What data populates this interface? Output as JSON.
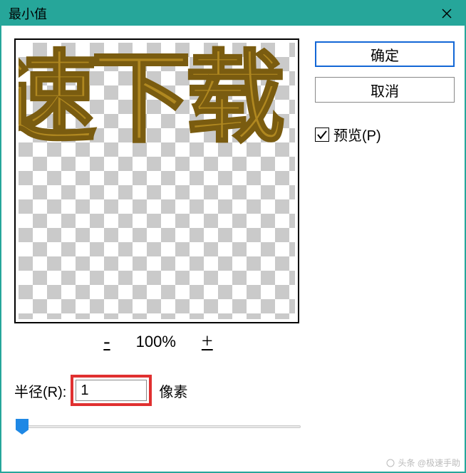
{
  "window": {
    "title": "最小值"
  },
  "preview": {
    "sample_text": "速下载"
  },
  "zoom": {
    "minus_label": "-",
    "percent": "100%",
    "plus_label": "+"
  },
  "radius": {
    "label": "半径(R):",
    "value": "1",
    "unit": "像素"
  },
  "buttons": {
    "ok": "确定",
    "cancel": "取消"
  },
  "preview_checkbox": {
    "label": "预览(P)",
    "checked": true
  },
  "watermark": {
    "text": "头条 @极速手助"
  }
}
